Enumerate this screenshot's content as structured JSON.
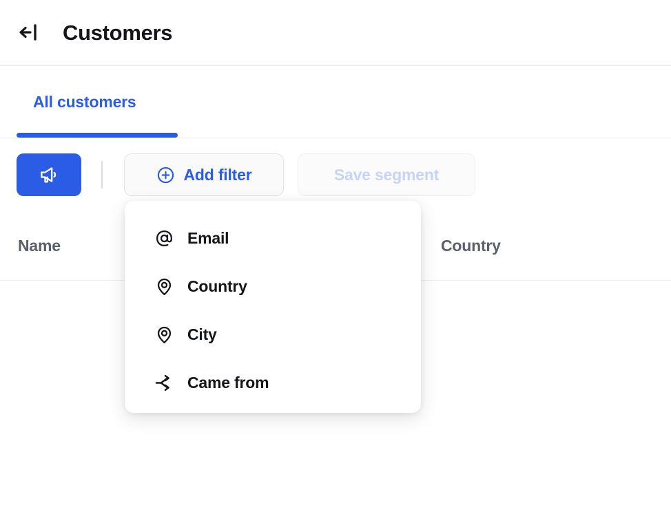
{
  "header": {
    "collapse_icon": "arrow-left-to-bar-icon",
    "title": "Customers"
  },
  "tabs": [
    {
      "label": "All customers",
      "active": true
    }
  ],
  "toolbar": {
    "broadcast_icon": "megaphone-icon",
    "add_filter": {
      "label": "Add filter",
      "icon": "plus-circle-icon",
      "enabled": true
    },
    "save_segment": {
      "label": "Save segment",
      "enabled": false
    }
  },
  "table": {
    "columns": [
      {
        "label": "Name"
      },
      {
        "label": "Country"
      }
    ],
    "rows": []
  },
  "filter_dropdown": {
    "open": true,
    "items": [
      {
        "label": "Email",
        "icon": "at-sign-icon"
      },
      {
        "label": "Country",
        "icon": "map-pin-icon"
      },
      {
        "label": "City",
        "icon": "map-pin-icon"
      },
      {
        "label": "Came from",
        "icon": "branch-arrows-icon"
      }
    ]
  },
  "colors": {
    "accent": "#2B5CE6",
    "text_primary": "#14161A",
    "text_muted": "#5B5F6B",
    "disabled_text": "#C7D4F6",
    "border": "#EDEDF0",
    "surface": "#FFFFFF"
  }
}
